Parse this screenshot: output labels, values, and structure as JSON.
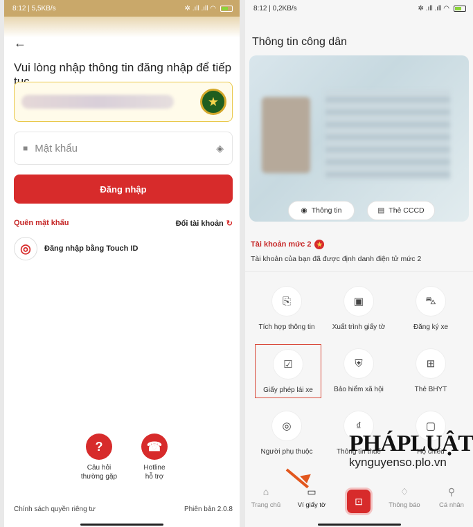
{
  "left": {
    "status": {
      "time": "8:12 | 5,5KB/s",
      "icons": "✲ .ıll .ıll ◠"
    },
    "back_icon": "←",
    "title": "Vui lòng nhập thông tin đăng nhập để tiếp tục",
    "password_placeholder": "Mật khẩu",
    "login_button": "Đăng nhập",
    "forgot_password": "Quên mật khẩu",
    "switch_account": "Đổi tài khoản",
    "touch_id": "Đăng nhập bằng Touch ID",
    "help_faq_line1": "Câu hỏi",
    "help_faq_line2": "thường gặp",
    "help_hotline_line1": "Hotline",
    "help_hotline_line2": "hỗ trợ",
    "privacy": "Chính sách quyền riêng tư",
    "version": "Phiên bản 2.0.8"
  },
  "right": {
    "status": {
      "time": "8:12 | 0,2KB/s",
      "icons": "✲ .ıll .ıll ◠"
    },
    "title": "Thông tin công dân",
    "pill_info": "Thông tin",
    "pill_card": "Thẻ CCCD",
    "account_level": "Tài khoản mức 2",
    "account_desc": "Tài khoản của bạn đã được định danh điện tử mức 2",
    "tiles": [
      {
        "label": "Tích hợp thông tin",
        "icon": "document-plus-icon"
      },
      {
        "label": "Xuất trình giấy tờ",
        "icon": "id-card-icon"
      },
      {
        "label": "Đăng ký xe",
        "icon": "car-icon"
      },
      {
        "label": "Giấy phép lái xe",
        "icon": "license-icon"
      },
      {
        "label": "Bảo hiểm xã hội",
        "icon": "shield-plus-icon"
      },
      {
        "label": "Thẻ BHYT",
        "icon": "health-card-icon"
      },
      {
        "label": "Người phụ thuộc",
        "icon": "person-icon"
      },
      {
        "label": "Thông tin thuế",
        "icon": "vnd-icon"
      },
      {
        "label": "Hộ chiếu",
        "icon": "passport-icon"
      }
    ],
    "watermark_logo": "PHÁPLUẬT",
    "watermark_url": "kynguyenso.plo.vn",
    "tabs": [
      {
        "label": "Trang chủ",
        "icon": "home-icon"
      },
      {
        "label": "Ví giấy tờ",
        "icon": "wallet-icon"
      },
      {
        "label": "Thông báo",
        "icon": "bell-icon"
      },
      {
        "label": "Cá nhân",
        "icon": "user-icon"
      }
    ]
  }
}
